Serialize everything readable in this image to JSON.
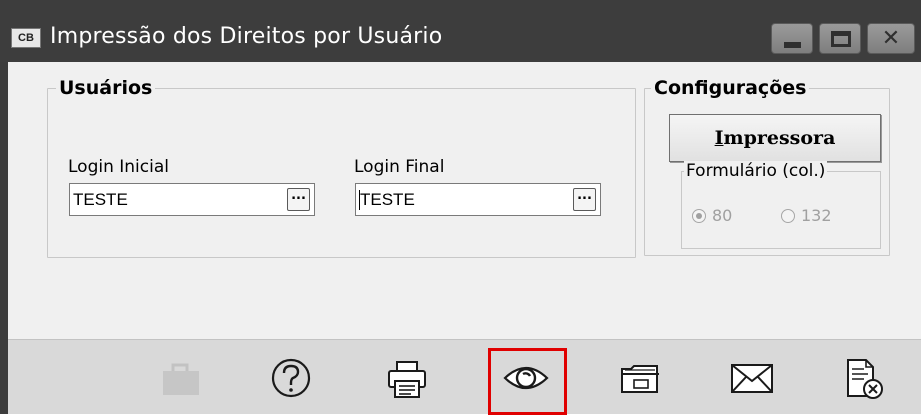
{
  "window": {
    "app_icon_text": "CB",
    "title": "Impressão dos Direitos por Usuário",
    "title_icons": [
      "minimize-icon",
      "maximize-icon",
      "close-icon"
    ],
    "close_glyph": "✕"
  },
  "users_group": {
    "legend": "Usuários",
    "login_inicial": {
      "label": "Login Inicial",
      "value": "TESTE",
      "lookup_label": "..."
    },
    "login_final": {
      "label": "Login Final",
      "value": "TESTE",
      "lookup_label": "..."
    }
  },
  "config_group": {
    "legend": "Configurações",
    "printer_button": {
      "underlined": "I",
      "rest": "mpressora"
    },
    "form_group": {
      "legend": "Formulário (col.)",
      "options": [
        {
          "label": "80",
          "checked": true
        },
        {
          "label": "132",
          "checked": false
        }
      ]
    }
  },
  "toolbar": {
    "buttons": [
      {
        "icon": "briefcase-icon",
        "enabled": false
      },
      {
        "icon": "help-icon",
        "enabled": true
      },
      {
        "icon": "printer-icon",
        "enabled": true
      },
      {
        "icon": "preview-eye-icon",
        "enabled": true,
        "highlighted": true
      },
      {
        "icon": "open-folder-icon",
        "enabled": true
      },
      {
        "icon": "mail-icon",
        "enabled": true
      },
      {
        "icon": "close-document-icon",
        "enabled": true
      }
    ],
    "highlight_color": "#e00000"
  },
  "colors": {
    "titlebar": "#3d3d3d",
    "client": "#f0f0f0",
    "toolbar": "#d9d9d9"
  }
}
